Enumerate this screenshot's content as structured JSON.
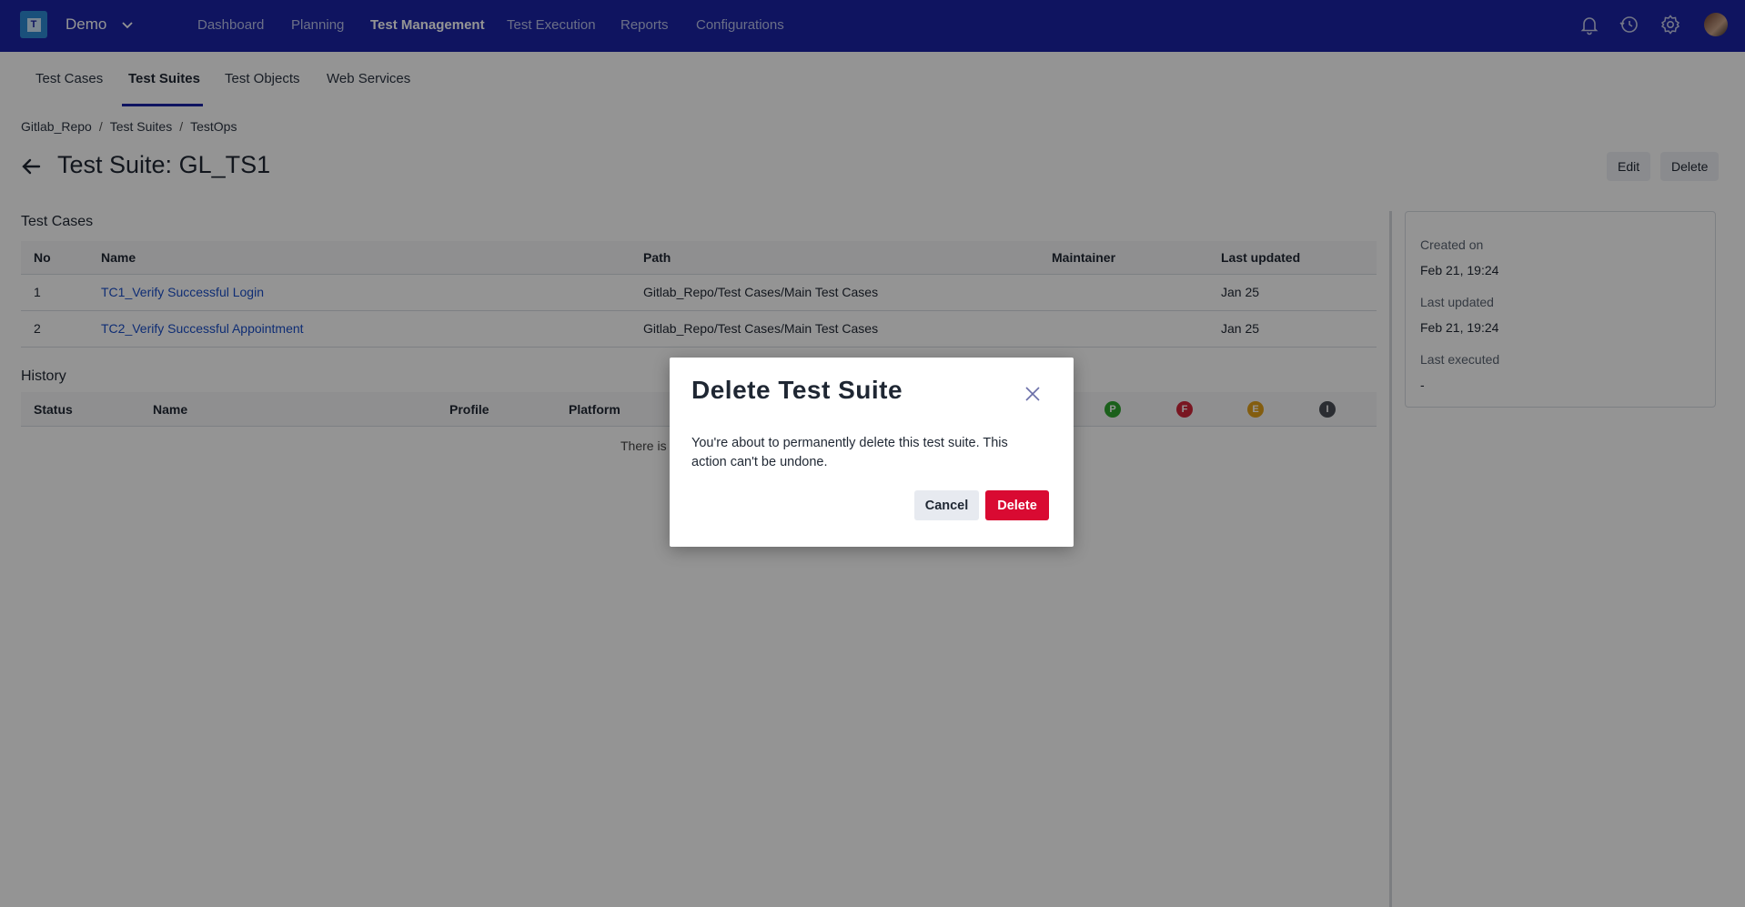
{
  "topnav": {
    "project": "Demo",
    "items": [
      "Dashboard",
      "Planning",
      "Test Management",
      "Test Execution",
      "Reports",
      "Configurations"
    ],
    "active": "Test Management"
  },
  "subtabs": [
    "Test Cases",
    "Test Suites",
    "Test Objects",
    "Web Services"
  ],
  "breadcrumb": [
    "Gitlab_Repo",
    "Test Suites",
    "TestOps"
  ],
  "page": {
    "title": "Test Suite: GL_TS1",
    "edit_label": "Edit",
    "delete_label": "Delete"
  },
  "test_cases": {
    "title": "Test Cases",
    "columns": [
      "No",
      "Name",
      "Path",
      "Maintainer",
      "Last updated"
    ],
    "rows": [
      {
        "no": "1",
        "name": "TC1_Verify Successful Login",
        "path": "Gitlab_Repo/Test Cases/Main Test Cases",
        "maintainer": "",
        "updated": "Jan 25"
      },
      {
        "no": "2",
        "name": "TC2_Verify Successful Appointment",
        "path": "Gitlab_Repo/Test Cases/Main Test Cases",
        "maintainer": "",
        "updated": "Jan 25"
      }
    ]
  },
  "history": {
    "title": "History",
    "columns": [
      "Status",
      "Name",
      "Profile",
      "Platform"
    ],
    "status_badges": [
      {
        "letter": "P",
        "color": "#2fa52f"
      },
      {
        "letter": "F",
        "color": "#d0263a"
      },
      {
        "letter": "E",
        "color": "#e2a11a"
      },
      {
        "letter": "I",
        "color": "#4a4f57"
      }
    ],
    "empty_text": "There is"
  },
  "info": {
    "created_label": "Created on",
    "created_value": "Feb 21, 19:24",
    "updated_label": "Last updated",
    "updated_value": "Feb 21, 19:24",
    "executed_label": "Last executed",
    "executed_value": "-"
  },
  "modal": {
    "title": "Delete Test Suite",
    "body": "You're about to permanently delete this test suite. This action can't be undone.",
    "cancel_label": "Cancel",
    "delete_label": "Delete"
  },
  "colors": {
    "topbar": "#1a24a6",
    "danger": "#d90a32",
    "link": "#1a4fc9"
  }
}
